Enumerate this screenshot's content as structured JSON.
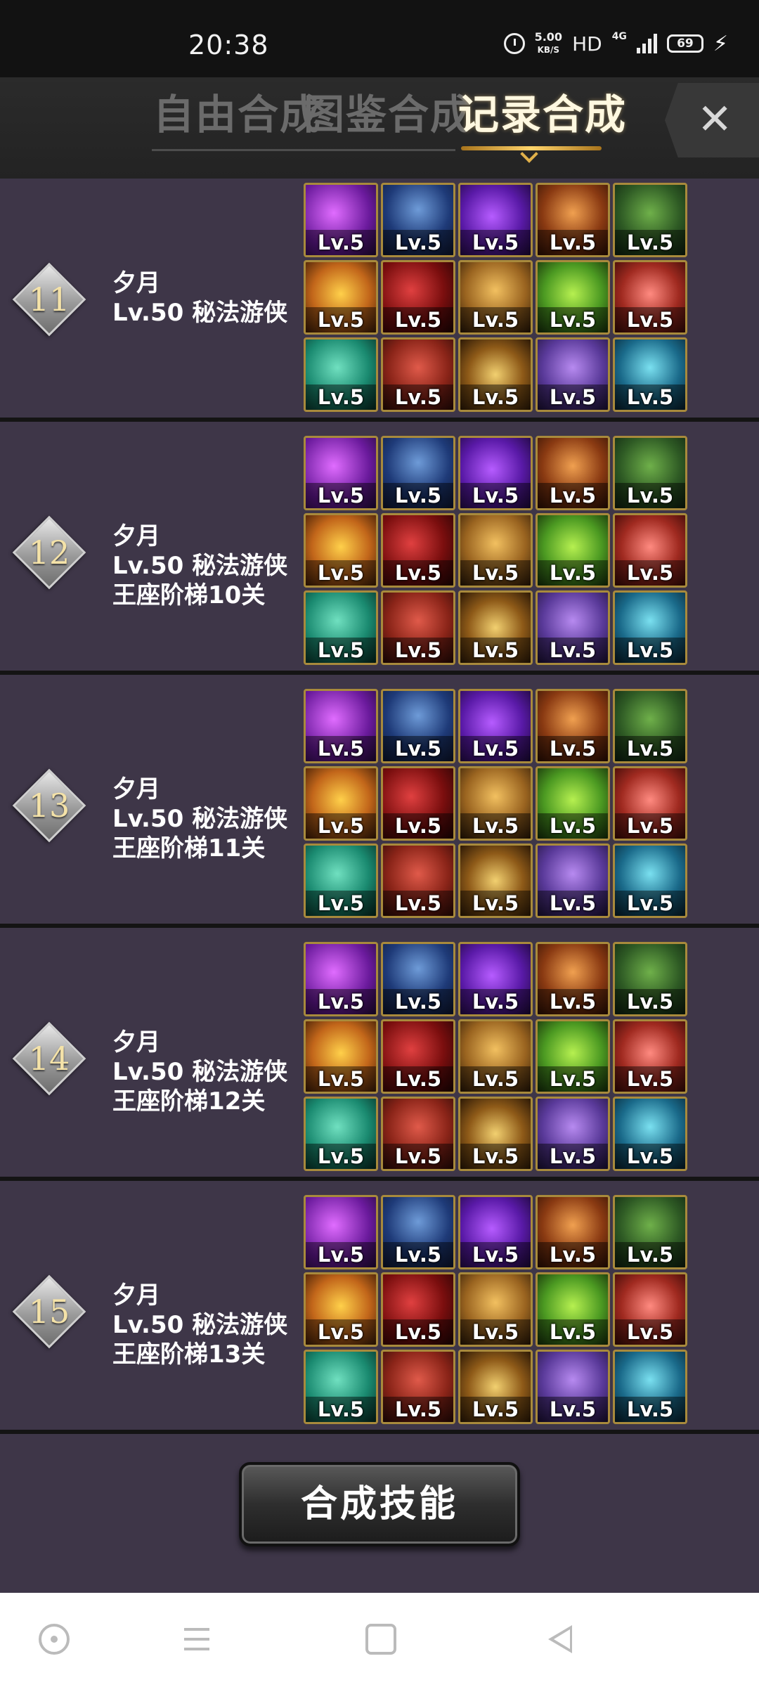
{
  "status_bar": {
    "time": "20:38",
    "speed_value": "5.00",
    "speed_unit": "KB/S",
    "hd": "HD",
    "network": "4G",
    "battery": "69"
  },
  "tabs": [
    {
      "label": "自由合成",
      "active": false
    },
    {
      "label": "图鉴合成",
      "active": false
    },
    {
      "label": "记录合成",
      "active": true
    }
  ],
  "records": [
    {
      "number": "11",
      "name": "夕月",
      "level_class": "Lv.50 秘法游侠",
      "note": ""
    },
    {
      "number": "12",
      "name": "夕月",
      "level_class": "Lv.50 秘法游侠",
      "note": "王座阶梯10关"
    },
    {
      "number": "13",
      "name": "夕月",
      "level_class": "Lv.50 秘法游侠",
      "note": "王座阶梯11关"
    },
    {
      "number": "14",
      "name": "夕月",
      "level_class": "Lv.50 秘法游侠",
      "note": "王座阶梯12关"
    },
    {
      "number": "15",
      "name": "夕月",
      "level_class": "Lv.50 秘法游侠",
      "note": "王座阶梯13关"
    }
  ],
  "skills": [
    {
      "icon": "purple-slash-skill-icon",
      "level": "Lv.5"
    },
    {
      "icon": "blue-shadow-skill-icon",
      "level": "Lv.5"
    },
    {
      "icon": "violet-flame-skill-icon",
      "level": "Lv.5"
    },
    {
      "icon": "eye-pyramid-skill-icon",
      "level": "Lv.5"
    },
    {
      "icon": "green-vine-skill-icon",
      "level": "Lv.5"
    },
    {
      "icon": "golden-fire-skill-icon",
      "level": "Lv.5"
    },
    {
      "icon": "red-orb-skill-icon",
      "level": "Lv.5"
    },
    {
      "icon": "steel-blade-skill-icon",
      "level": "Lv.5"
    },
    {
      "icon": "green-swirl-skill-icon",
      "level": "Lv.5"
    },
    {
      "icon": "red-shield-cross-skill-icon",
      "level": "Lv.5"
    },
    {
      "icon": "teal-leaf-skill-icon",
      "level": "Lv.5"
    },
    {
      "icon": "red-fist-skill-icon",
      "level": "Lv.5"
    },
    {
      "icon": "golden-compass-skill-icon",
      "level": "Lv.5"
    },
    {
      "icon": "purple-spirit-skill-icon",
      "level": "Lv.5"
    },
    {
      "icon": "cyan-wings-skill-icon",
      "level": "Lv.5"
    }
  ],
  "action": {
    "compose_label": "合成技能"
  }
}
